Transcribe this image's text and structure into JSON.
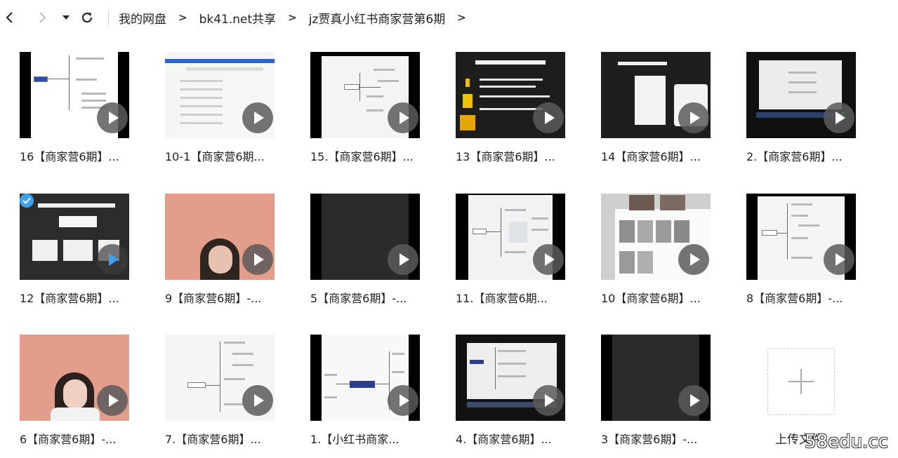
{
  "nav": {
    "back_icon": "chevron-left-icon",
    "forward_icon": "chevron-right-icon",
    "dropdown_icon": "caret-down-icon",
    "refresh_icon": "refresh-icon",
    "breadcrumbs": [
      "我的网盘",
      "bk41.net共享",
      "jz贾真小红书商家营第6期"
    ],
    "separator": ">"
  },
  "files": [
    {
      "name": "16【商家营6期】...",
      "thumb": "mindmap-left"
    },
    {
      "name": "10-1【商家营6期...",
      "thumb": "webpage"
    },
    {
      "name": "15.【商家营6期】...",
      "thumb": "mindmap"
    },
    {
      "name": "13【商家营6期】...",
      "thumb": "pyramid"
    },
    {
      "name": "14【商家营6期】...",
      "thumb": "dark-slide"
    },
    {
      "name": "2.【商家营6期】...",
      "thumb": "screen"
    },
    {
      "name": "12【商家营6期】...",
      "thumb": "dark-cards",
      "selected": true
    },
    {
      "name": "9【商家营6期】-...",
      "thumb": "person"
    },
    {
      "name": "5【商家营6期】-...",
      "thumb": "blank-dark"
    },
    {
      "name": "11.【商家营6期...",
      "thumb": "mindmap"
    },
    {
      "name": "10【商家营6期】...",
      "thumb": "photos"
    },
    {
      "name": "8【商家营6期】-...",
      "thumb": "mindmap-tree"
    },
    {
      "name": "6【商家营6期】-...",
      "thumb": "person"
    },
    {
      "name": "7.【商家营6期】...",
      "thumb": "mindmap-tree"
    },
    {
      "name": "1.【小红书商家...",
      "thumb": "mindmap-center"
    },
    {
      "name": "4.【商家营6期】...",
      "thumb": "screen"
    },
    {
      "name": "3【商家营6期】-...",
      "thumb": "blank-dark"
    }
  ],
  "upload": {
    "label": "上传文件",
    "icon": "plus-icon"
  },
  "watermark": "58edu.cc",
  "colors": {
    "accent": "#3ea0f0",
    "thumb_bg": "#000000",
    "pink": "#e7a08e"
  }
}
